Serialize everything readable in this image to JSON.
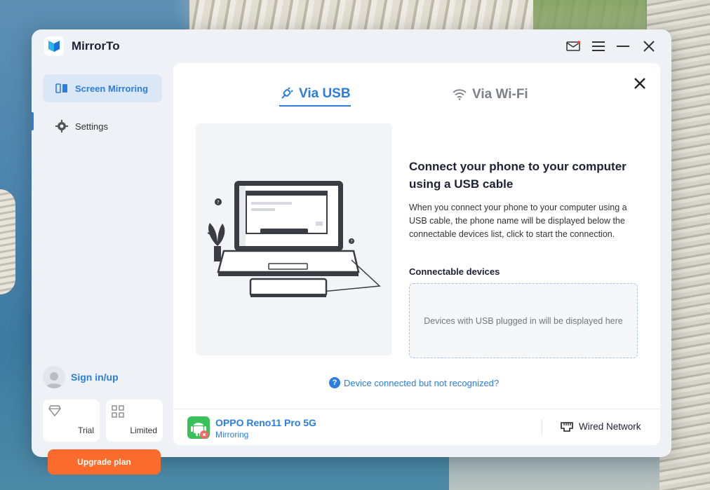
{
  "app": {
    "title": "MirrorTo"
  },
  "sidebar": {
    "items": [
      {
        "label": "Screen Mirroring",
        "icon": "screen-mirroring-icon",
        "active": true
      },
      {
        "label": "Settings",
        "icon": "gear-icon",
        "active": false
      }
    ],
    "signin_label": "Sign in/up",
    "plans": [
      {
        "label": "Trial",
        "icon": "diamond-icon"
      },
      {
        "label": "Limited",
        "icon": "grid-icon"
      }
    ],
    "upgrade_label": "Upgrade plan"
  },
  "tabs": [
    {
      "label": "Via USB",
      "icon": "usb-plug-icon",
      "active": true
    },
    {
      "label": "Via Wi-Fi",
      "icon": "wifi-icon",
      "active": false
    }
  ],
  "main": {
    "title": "Connect your phone to your computer using a USB cable",
    "description": "When you connect your phone to your computer using a USB cable, the phone name will be displayed below the connectable devices list, click to start the connection.",
    "devices_label": "Connectable devices",
    "devices_placeholder": "Devices with USB plugged in will be displayed here",
    "help_link": "Device connected but not recognized?"
  },
  "bottom": {
    "device_name": "OPPO Reno11 Pro 5G",
    "device_status": "Mirroring",
    "network_label": "Wired Network"
  },
  "colors": {
    "accent": "#2a7de1",
    "upgrade": "#fa6b2c",
    "android": "#3ac25a"
  }
}
